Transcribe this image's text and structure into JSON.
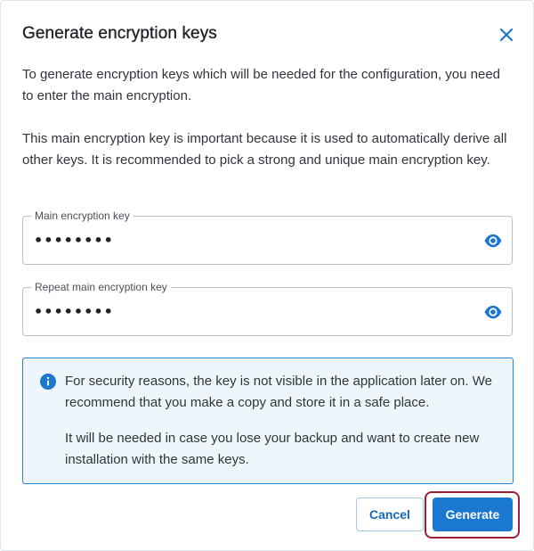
{
  "dialog": {
    "title": "Generate encryption keys",
    "close_icon": "close-icon",
    "intro_text": "To generate encryption keys which will be needed for the configuration, you need to enter the main encryption.",
    "importance_text": "This main encryption key is important because it is used to automatically derive all other keys. It is recommended to pick a strong and unique main encryption key."
  },
  "fields": {
    "main_key": {
      "label": "Main encryption key",
      "value": "••••••••",
      "toggle_icon": "eye-icon"
    },
    "repeat_key": {
      "label": "Repeat main encryption key",
      "value": "••••••••",
      "toggle_icon": "eye-icon"
    }
  },
  "notice": {
    "icon": "info-icon",
    "text_1": "For security reasons, the key is not visible in the application later on. We recommend that you make a copy and store it in a safe place.",
    "text_2": "It will be needed in case you lose your backup and want to create new installation with the same keys."
  },
  "actions": {
    "cancel_label": "Cancel",
    "generate_label": "Generate"
  },
  "colors": {
    "accent": "#1b78d0",
    "notice_background": "#eef6fc",
    "notice_border": "#1f86d6",
    "highlight": "#a01d33"
  }
}
